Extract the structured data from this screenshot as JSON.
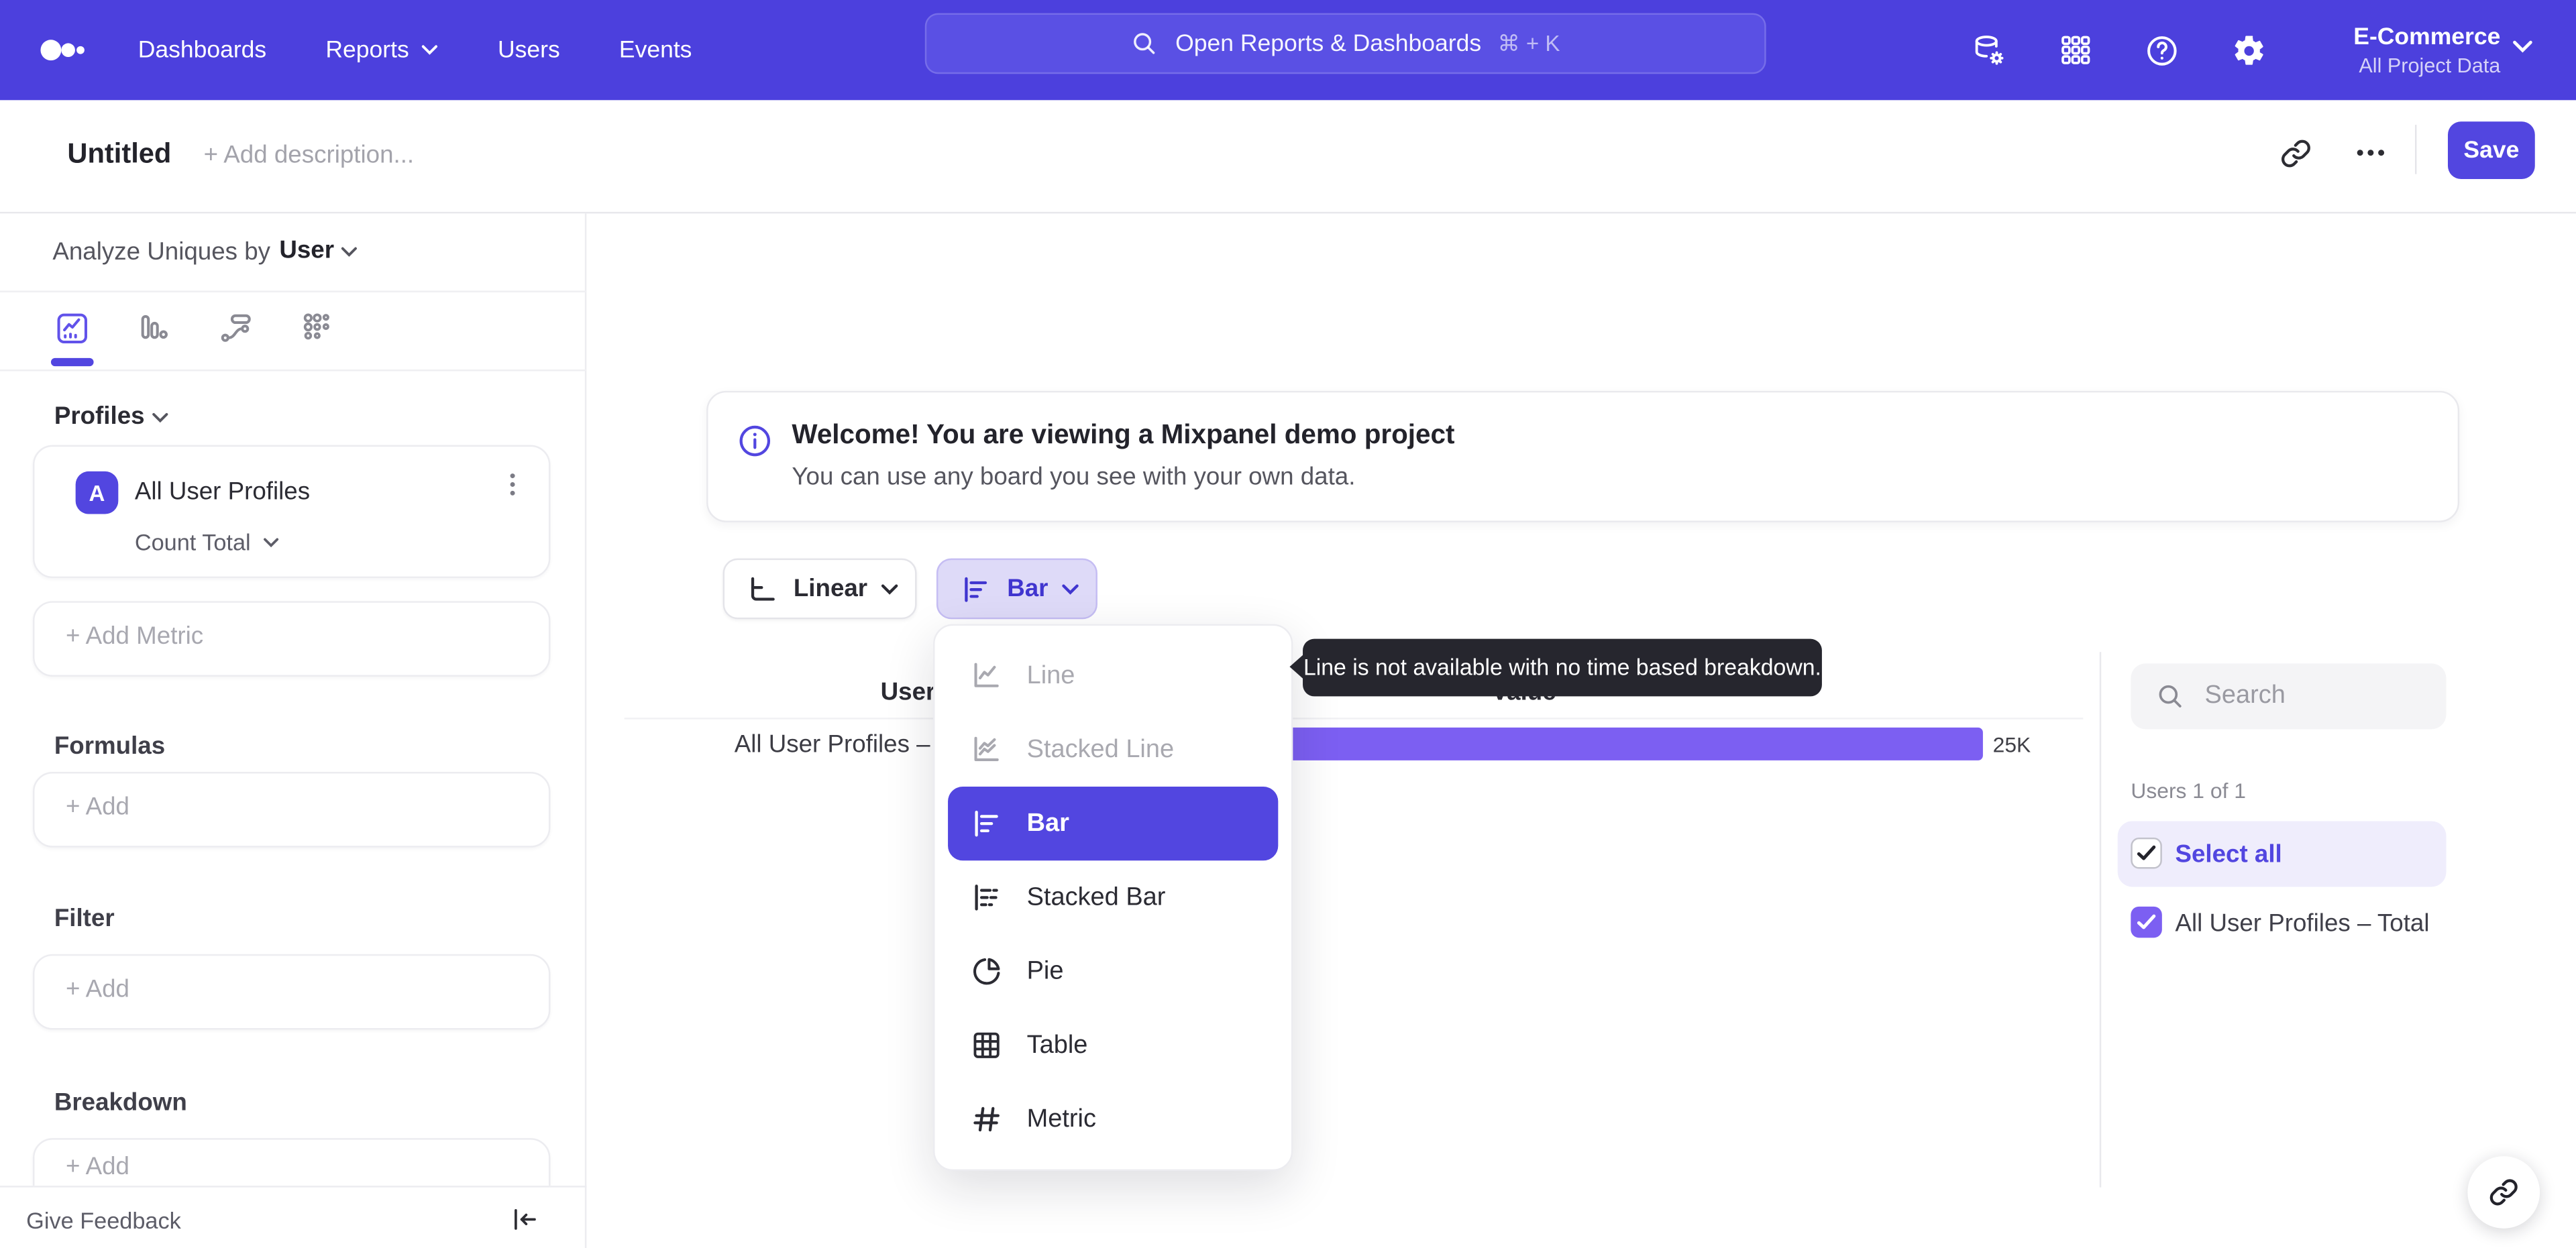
{
  "nav": {
    "links": [
      "Dashboards",
      "Reports",
      "Users",
      "Events"
    ],
    "search": {
      "placeholder": "Open Reports & Dashboards",
      "shortcut": "⌘ + K"
    },
    "project": {
      "name": "E-Commerce",
      "scope": "All Project Data"
    }
  },
  "toolbar": {
    "title": "Untitled",
    "description_placeholder": "+ Add description...",
    "save_label": "Save"
  },
  "sidebar": {
    "analyze_prefix": "Analyze Uniques by",
    "analyze_value": "User",
    "profiles_label": "Profiles",
    "metric_card": {
      "badge": "A",
      "name": "All User Profiles",
      "aggregation": "Count Total"
    },
    "add_metric_label": "+ Add Metric",
    "formulas_label": "Formulas",
    "formulas_add_label": "+ Add",
    "filter_label": "Filter",
    "filter_add_label": "+ Add",
    "breakdown_label": "Breakdown",
    "breakdown_add_label": "+ Add",
    "feedback_label": "Give Feedback"
  },
  "banner": {
    "title": "Welcome! You are viewing a Mixpanel demo project",
    "subtitle": "You can use any board you see with your own data."
  },
  "controls": {
    "scale": "Linear",
    "chart_type": "Bar"
  },
  "chart_menu": {
    "items": [
      {
        "label": "Line",
        "state": "disabled"
      },
      {
        "label": "Stacked Line",
        "state": "disabled"
      },
      {
        "label": "Bar",
        "state": "selected"
      },
      {
        "label": "Stacked Bar",
        "state": "default"
      },
      {
        "label": "Pie",
        "state": "default"
      },
      {
        "label": "Table",
        "state": "default"
      },
      {
        "label": "Metric",
        "state": "default"
      }
    ]
  },
  "tooltip": {
    "text": "Line is not available with no time based breakdown."
  },
  "chart_data": {
    "type": "bar",
    "orientation": "horizontal",
    "column_headers": [
      "Users",
      "Value"
    ],
    "categories": [
      "All User Profiles – Total"
    ],
    "series": [
      {
        "name": "All User Profiles – Total",
        "values": [
          25000
        ]
      }
    ],
    "value_labels": [
      "25K"
    ],
    "axis_max": 25000,
    "bar_color": "#7c5ff2",
    "grid": false,
    "legend": "none"
  },
  "right_panel": {
    "search_placeholder": "Search",
    "count_label": "Users 1 of 1",
    "select_all_label": "Select all",
    "items": [
      {
        "label": "All User Profiles – Total",
        "checked": true
      }
    ]
  },
  "colors": {
    "nav_bg": "#4c40dd",
    "accent": "#5246e0",
    "bar": "#7c5ff2",
    "chart_button_bg": "#dedaf8",
    "tooltip_bg": "#26262e"
  }
}
